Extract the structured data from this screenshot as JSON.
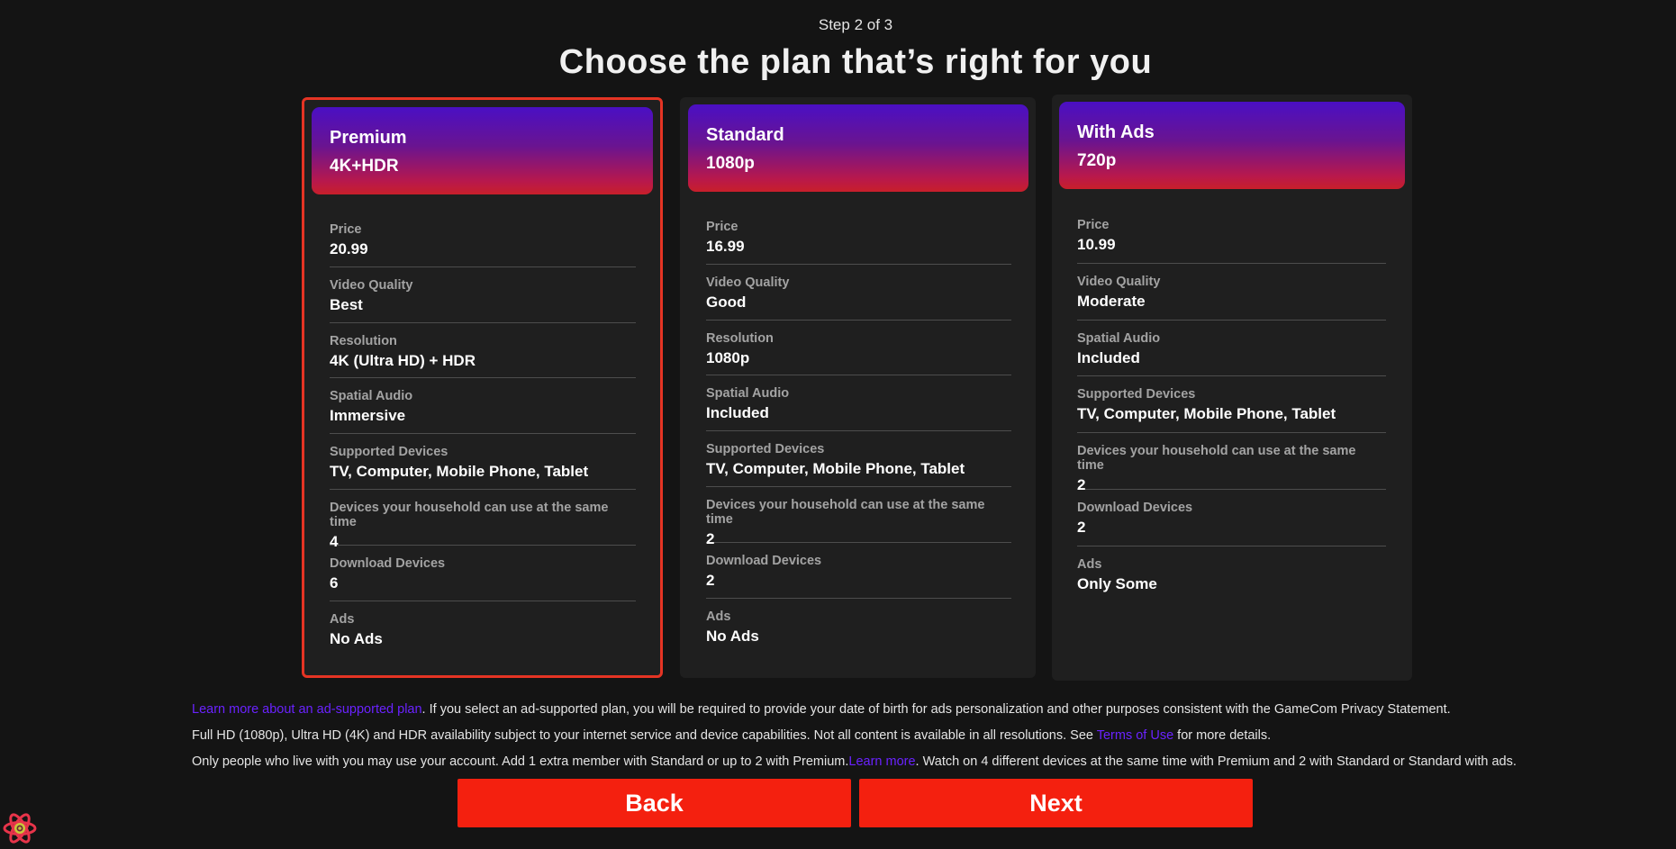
{
  "header": {
    "step": "Step 2 of 3",
    "title": "Choose the plan that’s right for you"
  },
  "plans": [
    {
      "name": "Premium",
      "resolution": "4K+HDR",
      "selected": true,
      "rows": [
        {
          "label": "Price",
          "value": "20.99"
        },
        {
          "label": "Video Quality",
          "value": "Best"
        },
        {
          "label": "Resolution",
          "value": "4K (Ultra HD) + HDR"
        },
        {
          "label": "Spatial Audio",
          "value": "Immersive"
        },
        {
          "label": "Supported Devices",
          "value": "TV, Computer, Mobile Phone, Tablet"
        },
        {
          "label": "Devices your household can use at the same time",
          "value": "4"
        },
        {
          "label": "Download Devices",
          "value": "6"
        },
        {
          "label": "Ads",
          "value": "No Ads"
        }
      ]
    },
    {
      "name": "Standard",
      "resolution": "1080p",
      "selected": false,
      "rows": [
        {
          "label": "Price",
          "value": "16.99"
        },
        {
          "label": "Video Quality",
          "value": "Good"
        },
        {
          "label": "Resolution",
          "value": "1080p"
        },
        {
          "label": "Spatial Audio",
          "value": "Included"
        },
        {
          "label": "Supported Devices",
          "value": "TV, Computer, Mobile Phone, Tablet"
        },
        {
          "label": "Devices your household can use at the same time",
          "value": "2"
        },
        {
          "label": "Download Devices",
          "value": "2"
        },
        {
          "label": "Ads",
          "value": "No Ads"
        }
      ]
    },
    {
      "name": "With Ads",
      "resolution": "720p",
      "selected": false,
      "rows": [
        {
          "label": "Price",
          "value": "10.99"
        },
        {
          "label": "Video Quality",
          "value": "Moderate"
        },
        {
          "label": "Spatial Audio",
          "value": "Included"
        },
        {
          "label": "Supported Devices",
          "value": "TV, Computer, Mobile Phone, Tablet"
        },
        {
          "label": "Devices your household can use at the same time",
          "value": "2"
        },
        {
          "label": "Download Devices",
          "value": "2"
        },
        {
          "label": "Ads",
          "value": "Only Some"
        }
      ]
    }
  ],
  "footer": {
    "line1_link": "Learn more about an ad-supported plan",
    "line1_text": ". If you select an ad-supported plan, you will be required to provide your date of birth for ads personalization and other purposes consistent with the GameCom Privacy Statement.",
    "line2_text_a": "Full HD (1080p), Ultra HD (4K) and HDR availability subject to your internet service and device capabilities. Not all content is available in all resolutions. See ",
    "line2_link": "Terms of Use",
    "line2_text_b": " for more details.",
    "line3_text_a": "Only people who live with you may use your account. Add 1 extra member with Standard or up to 2 with Premium.",
    "line3_link": "Learn more",
    "line3_text_b": ". Watch on 4 different devices at the same time with Premium and 2 with Standard or Standard with ads."
  },
  "buttons": {
    "back": "Back",
    "next": "Next"
  },
  "colors": {
    "background": "#141414",
    "card": "#1f1f1f",
    "accent_red": "#f4200f",
    "link": "#6a22ff",
    "selected_border": "#e53424"
  },
  "icons": {
    "corner_logo": "react-atom-icon"
  }
}
